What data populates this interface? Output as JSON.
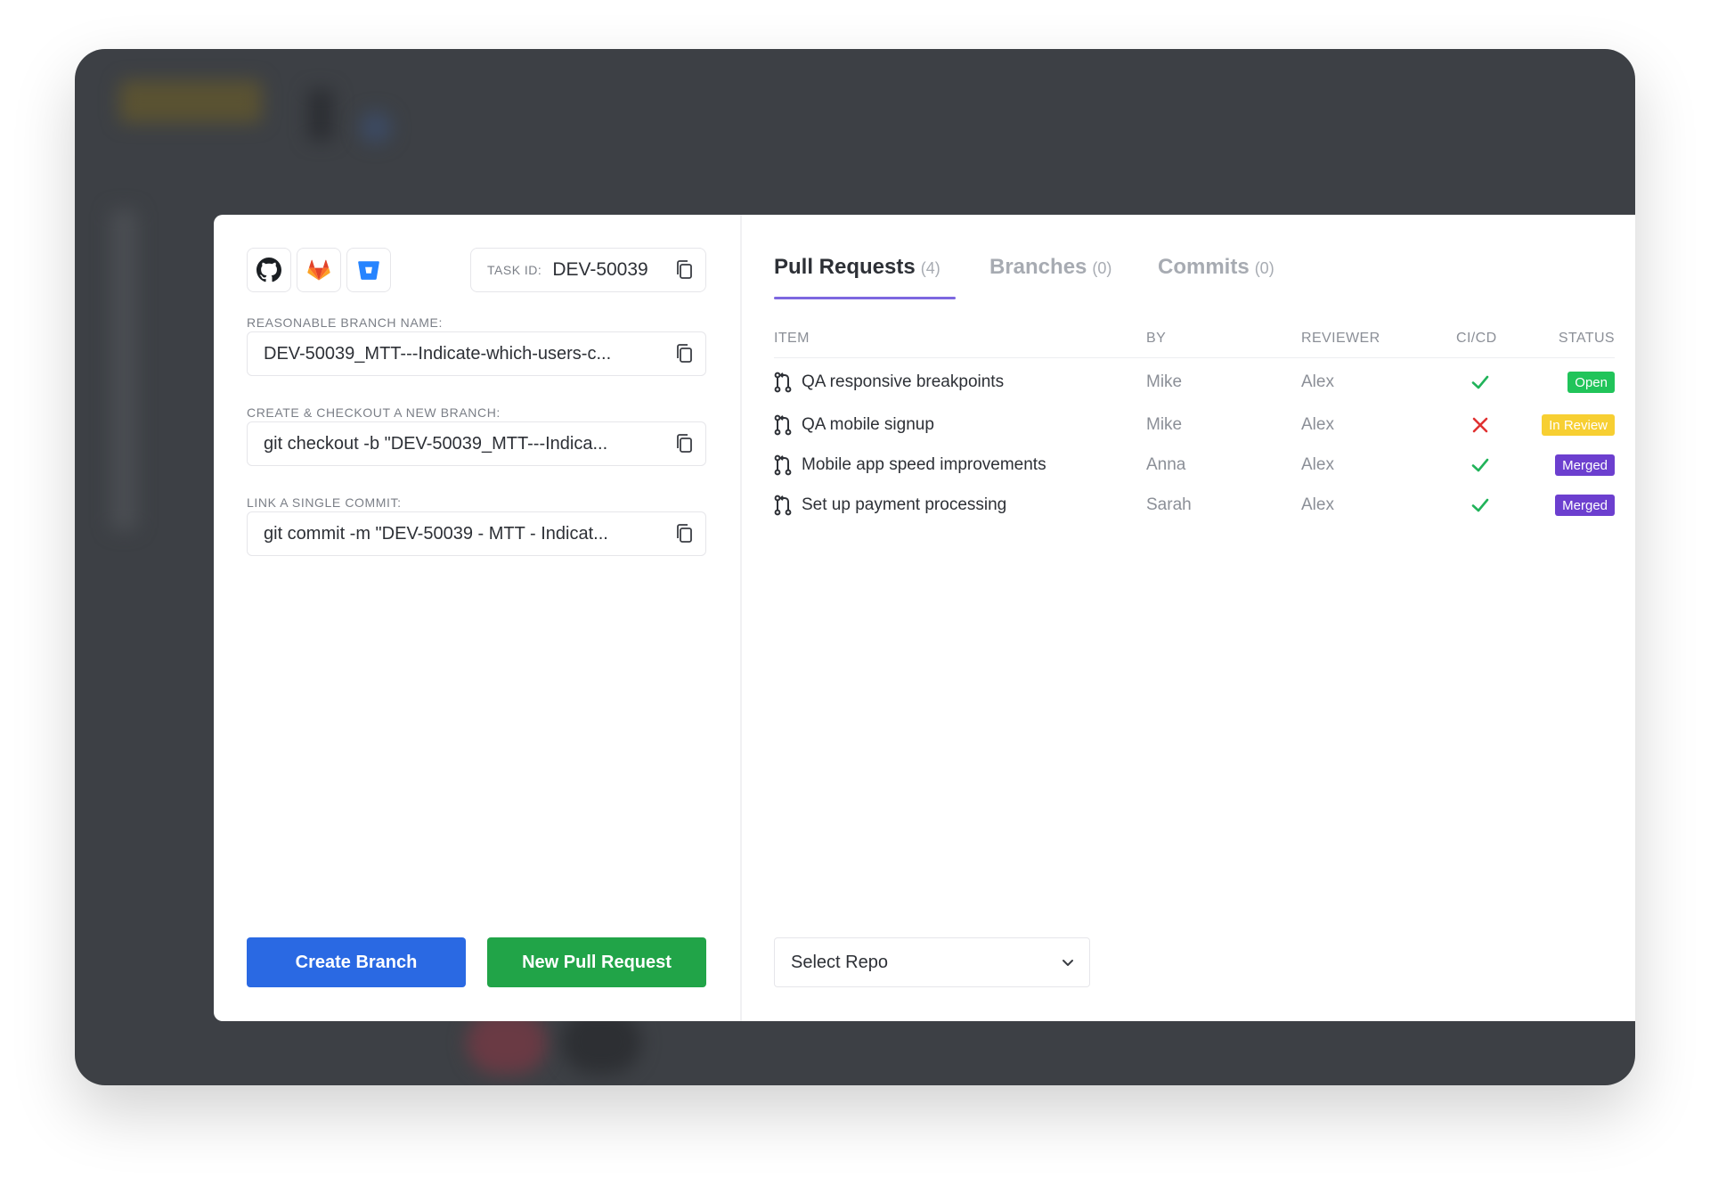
{
  "providers": [
    {
      "icon": "github-icon",
      "color": "#1b1f23"
    },
    {
      "icon": "gitlab-icon",
      "color": "#e24329"
    },
    {
      "icon": "bitbucket-icon",
      "color": "#2684ff"
    }
  ],
  "task": {
    "label": "TASK ID:",
    "value": "DEV-50039"
  },
  "fields": {
    "branch_name": {
      "label": "REASONABLE BRANCH NAME:",
      "value": "DEV-50039_MTT---Indicate-which-users-c..."
    },
    "checkout": {
      "label": "CREATE & CHECKOUT A NEW BRANCH:",
      "value": "git checkout -b \"DEV-50039_MTT---Indica..."
    },
    "commit": {
      "label": "LINK A SINGLE COMMIT:",
      "value": "git commit -m \"DEV-50039 - MTT - Indicat..."
    }
  },
  "buttons": {
    "create_branch": "Create Branch",
    "new_pull_request": "New Pull Request"
  },
  "tabs": [
    {
      "label": "Pull Requests",
      "count": "(4)",
      "active": true
    },
    {
      "label": "Branches",
      "count": "(0)",
      "active": false
    },
    {
      "label": "Commits",
      "count": "(0)",
      "active": false
    }
  ],
  "table": {
    "headers": {
      "item": "ITEM",
      "by": "BY",
      "reviewer": "REVIEWER",
      "cicd": "CI/CD",
      "status": "STATUS"
    },
    "rows": [
      {
        "title": "QA responsive breakpoints",
        "by": "Mike",
        "reviewer": "Alex",
        "ci": "pass",
        "status": "Open",
        "status_color": "#21c45a"
      },
      {
        "title": "QA mobile signup",
        "by": "Mike",
        "reviewer": "Alex",
        "ci": "fail",
        "status": "In Review",
        "status_color": "#f7cf32"
      },
      {
        "title": "Mobile app speed improvements",
        "by": "Anna",
        "reviewer": "Alex",
        "ci": "pass",
        "status": "Merged",
        "status_color": "#6c3fcf"
      },
      {
        "title": "Set up payment processing",
        "by": "Sarah",
        "reviewer": "Alex",
        "ci": "pass",
        "status": "Merged",
        "status_color": "#6c3fcf"
      }
    ]
  },
  "repo_select": {
    "value": "Select Repo"
  },
  "colors": {
    "accent": "#7d67e0",
    "primary": "#2a69e3",
    "success": "#21a448",
    "fail": "#e03131"
  }
}
